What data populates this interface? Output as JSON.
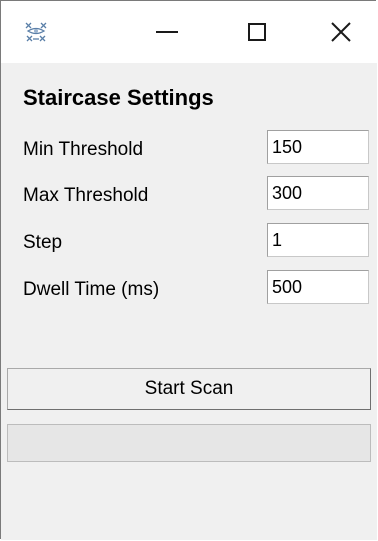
{
  "window": {
    "controls": {
      "minimize_icon": "minimize-icon",
      "maximize_icon": "maximize-icon",
      "close_icon": "close-icon"
    }
  },
  "panel": {
    "title": "Staircase Settings",
    "fields": [
      {
        "label": "Min Threshold",
        "value": "150"
      },
      {
        "label": "Max Threshold",
        "value": "300"
      },
      {
        "label": "Step",
        "value": "1"
      },
      {
        "label": "Dwell Time (ms)",
        "value": "500"
      }
    ],
    "start_button_label": "Start Scan",
    "progress_fraction": 0
  },
  "colors": {
    "titlebar_bg": "#ffffff",
    "window_bg": "#f0f0f0",
    "progress_fill": "#06b025"
  }
}
